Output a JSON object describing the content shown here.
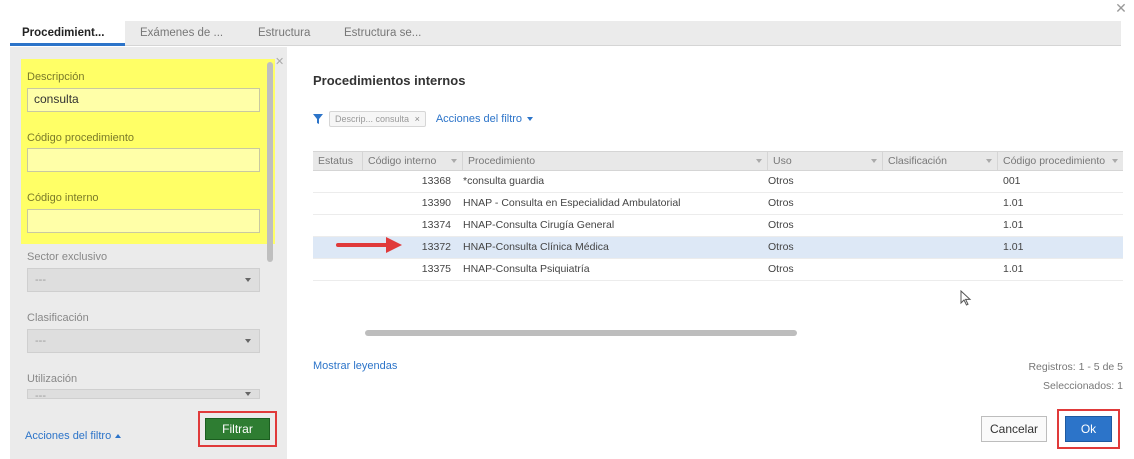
{
  "dialog": {
    "close_icon": "close-icon"
  },
  "tabs": [
    {
      "label": "Procedimient..."
    },
    {
      "label": "Exámenes de ..."
    },
    {
      "label": "Estructura"
    },
    {
      "label": "Estructura se..."
    }
  ],
  "filters": {
    "descripcion_label": "Descripción",
    "descripcion_value": "consulta",
    "codigo_procedimiento_label": "Código procedimiento",
    "codigo_procedimiento_value": "",
    "codigo_interno_label": "Código interno",
    "codigo_interno_value": "",
    "sector_label": "Sector exclusivo",
    "sector_value": "---",
    "clasificacion_label": "Clasificación",
    "clasificacion_value": "---",
    "utilizacion_label": "Utilización",
    "utilizacion_value": "---",
    "acciones_label": "Acciones del filtro",
    "filtrar_label": "Filtrar",
    "highlight_color": "#ffff66"
  },
  "main": {
    "title": "Procedimientos internos",
    "chip_field": "Descrip...",
    "chip_value": "consulta",
    "chip_close": "×",
    "acciones_label": "Acciones del filtro",
    "columns": [
      "Estatus",
      "Código interno",
      "Procedimiento",
      "Uso",
      "Clasificación",
      "Código procedimiento"
    ],
    "rows": [
      {
        "estatus": "",
        "codigo": "13368",
        "procedimiento": "*consulta guardia",
        "uso": "Otros",
        "clasificacion": "",
        "codigo_proc": "001"
      },
      {
        "estatus": "",
        "codigo": "13390",
        "procedimiento": "HNAP - Consulta en Especialidad Ambulatorial",
        "uso": "Otros",
        "clasificacion": "",
        "codigo_proc": "1.01"
      },
      {
        "estatus": "",
        "codigo": "13374",
        "procedimiento": "HNAP-Consulta Cirugía General",
        "uso": "Otros",
        "clasificacion": "",
        "codigo_proc": "1.01"
      },
      {
        "estatus": "",
        "codigo": "13372",
        "procedimiento": "HNAP-Consulta Clínica Médica",
        "uso": "Otros",
        "clasificacion": "",
        "codigo_proc": "1.01"
      },
      {
        "estatus": "",
        "codigo": "13375",
        "procedimiento": "HNAP-Consulta Psiquiatría",
        "uso": "Otros",
        "clasificacion": "",
        "codigo_proc": "1.01"
      }
    ],
    "selected_row_index": 3,
    "mostrar_leyendas": "Mostrar leyendas",
    "registros": "Registros: 1 - 5 de 5",
    "seleccionados": "Seleccionados: 1",
    "cancel_label": "Cancelar",
    "ok_label": "Ok",
    "accent_color": "#2c74c9",
    "annotation_color": "#e03a3a"
  }
}
